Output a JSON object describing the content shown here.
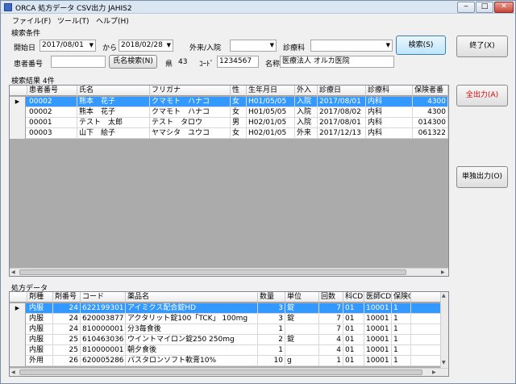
{
  "window": {
    "title": "ORCA 処方データ CSV出力  JAHIS2",
    "min": "‒",
    "max": "□",
    "close": "✕"
  },
  "menu": [
    "ファイル(F)",
    "ツール(T)",
    "ヘルプ(H)"
  ],
  "search": {
    "section": "検索条件",
    "start_label": "開始日",
    "start_value": "2017/08/01",
    "from_label": "から",
    "end_value": "2018/02/28",
    "visit_label": "外来/入院",
    "visit_value": "",
    "dept_label": "診療科",
    "dept_value": "",
    "search_button": "検索(S)",
    "patient_no_label": "患者番号",
    "patient_no_value": "",
    "name_search_button": "氏名検索(N)",
    "pref_label": "県",
    "pref_value": "43",
    "code_label": "ｺｰﾄﾞ",
    "code_value": "1234567",
    "org_label": "名称",
    "org_value": "医療法人 オルカ医院"
  },
  "buttons": {
    "exit": "終了(X)",
    "all_output": "全出力(A)",
    "single_output": "単独出力(O)"
  },
  "results": {
    "label": "検索結果 4件",
    "columns": [
      "患者番号",
      "氏名",
      "フリガナ",
      "性",
      "生年月日",
      "外入",
      "診療日",
      "診療科",
      "保険者番"
    ],
    "rows": [
      [
        "00002",
        "熊本　花子",
        "クマモト　ハナコ",
        "女",
        "H01/05/05",
        "入院",
        "2017/08/01",
        "内科",
        "4300"
      ],
      [
        "00002",
        "熊本　花子",
        "クマモト　ハナコ",
        "女",
        "H01/05/05",
        "入院",
        "2017/08/02",
        "内科",
        "4300"
      ],
      [
        "00001",
        "テスト　太郎",
        "テスト　タロウ",
        "男",
        "H02/01/05",
        "入院",
        "2017/08/01",
        "内科",
        "014300"
      ],
      [
        "00003",
        "山下　絵子",
        "ヤマシタ　ユウコ",
        "女",
        "H02/01/05",
        "外来",
        "2017/12/13",
        "内科",
        "061322"
      ]
    ]
  },
  "prescription": {
    "label": "処方データ",
    "columns": [
      "剤種",
      "剤番号",
      "コード",
      "薬品名",
      "数量",
      "単位",
      "回数",
      "科CD",
      "医師CD",
      "保険C"
    ],
    "rows": [
      [
        "内服",
        "24",
        "622199301",
        "アイミクス配合錠HD",
        "3",
        "錠",
        "7",
        "01",
        "10001",
        "1"
      ],
      [
        "内服",
        "24",
        "620003877",
        "アクタリット錠100「TCK」 100mg",
        "3",
        "錠",
        "7",
        "01",
        "10001",
        "1"
      ],
      [
        "内服",
        "24",
        "810000001",
        "分3毎食後",
        "1",
        "",
        "7",
        "01",
        "10001",
        "1"
      ],
      [
        "内服",
        "25",
        "610463036",
        "ウイントマイロン錠250  250mg",
        "2",
        "錠",
        "4",
        "01",
        "10001",
        "1"
      ],
      [
        "内服",
        "25",
        "810000001",
        "朝夕食後",
        "1",
        "",
        "4",
        "01",
        "10001",
        "1"
      ],
      [
        "外用",
        "26",
        "620005286",
        "パスタロンソフト軟膏10%",
        "10",
        "g",
        "1",
        "01",
        "10001",
        "1"
      ]
    ]
  }
}
